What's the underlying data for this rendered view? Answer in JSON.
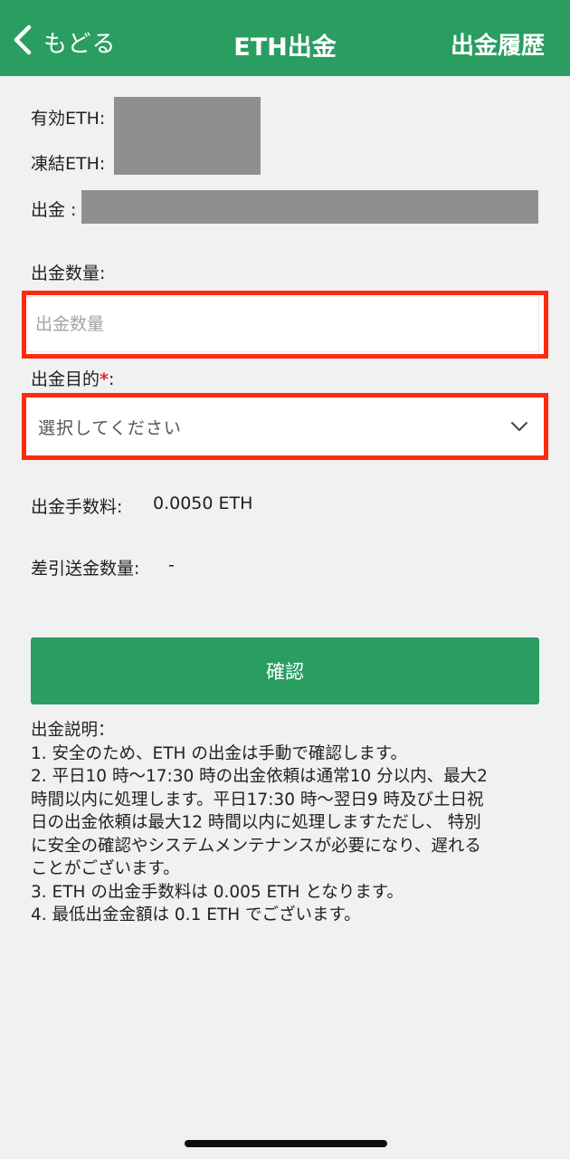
{
  "header": {
    "back_label": "もどる",
    "title": "ETH出金",
    "history_label": "出金履歴"
  },
  "balances": {
    "available_label": "有効ETH:",
    "frozen_label": "凍結ETH:",
    "address_label": "出金 :"
  },
  "form": {
    "amount_label": "出金数量:",
    "amount_placeholder": "出金数量",
    "purpose_label": "出金目的",
    "purpose_required_mark": "*",
    "purpose_colon": ":",
    "purpose_placeholder": "選択してください"
  },
  "fees": {
    "fee_label": "出金手数料:",
    "fee_value": "0.0050 ETH",
    "net_label": "差引送金数量:",
    "net_value": "-"
  },
  "confirm_label": "確認",
  "notes": {
    "lines": [
      "出金説明：",
      "1. 安全のため、ETH の出金は手動で確認します。",
      "2. 平日10 時～17:30 時の出金依頼は通常10 分以内、最大2",
      "時間以内に処理します。平日17:30 時～翌日9 時及び土日祝",
      "日の出金依頼は最大12 時間以内に処理しますただし、 特別",
      "に安全の確認やシステムメンテナンスが必要になり、遅れる",
      "ことがございます。",
      "3. ETH の出金手数料は 0.005 ETH となります。",
      "4. 最低出金金額は 0.1 ETH でございます。"
    ]
  },
  "colors": {
    "brand_green": "#2a9d61",
    "highlight_red": "#ff2b10",
    "required_red": "#e0252b",
    "mask_gray": "#8f8f8f"
  }
}
